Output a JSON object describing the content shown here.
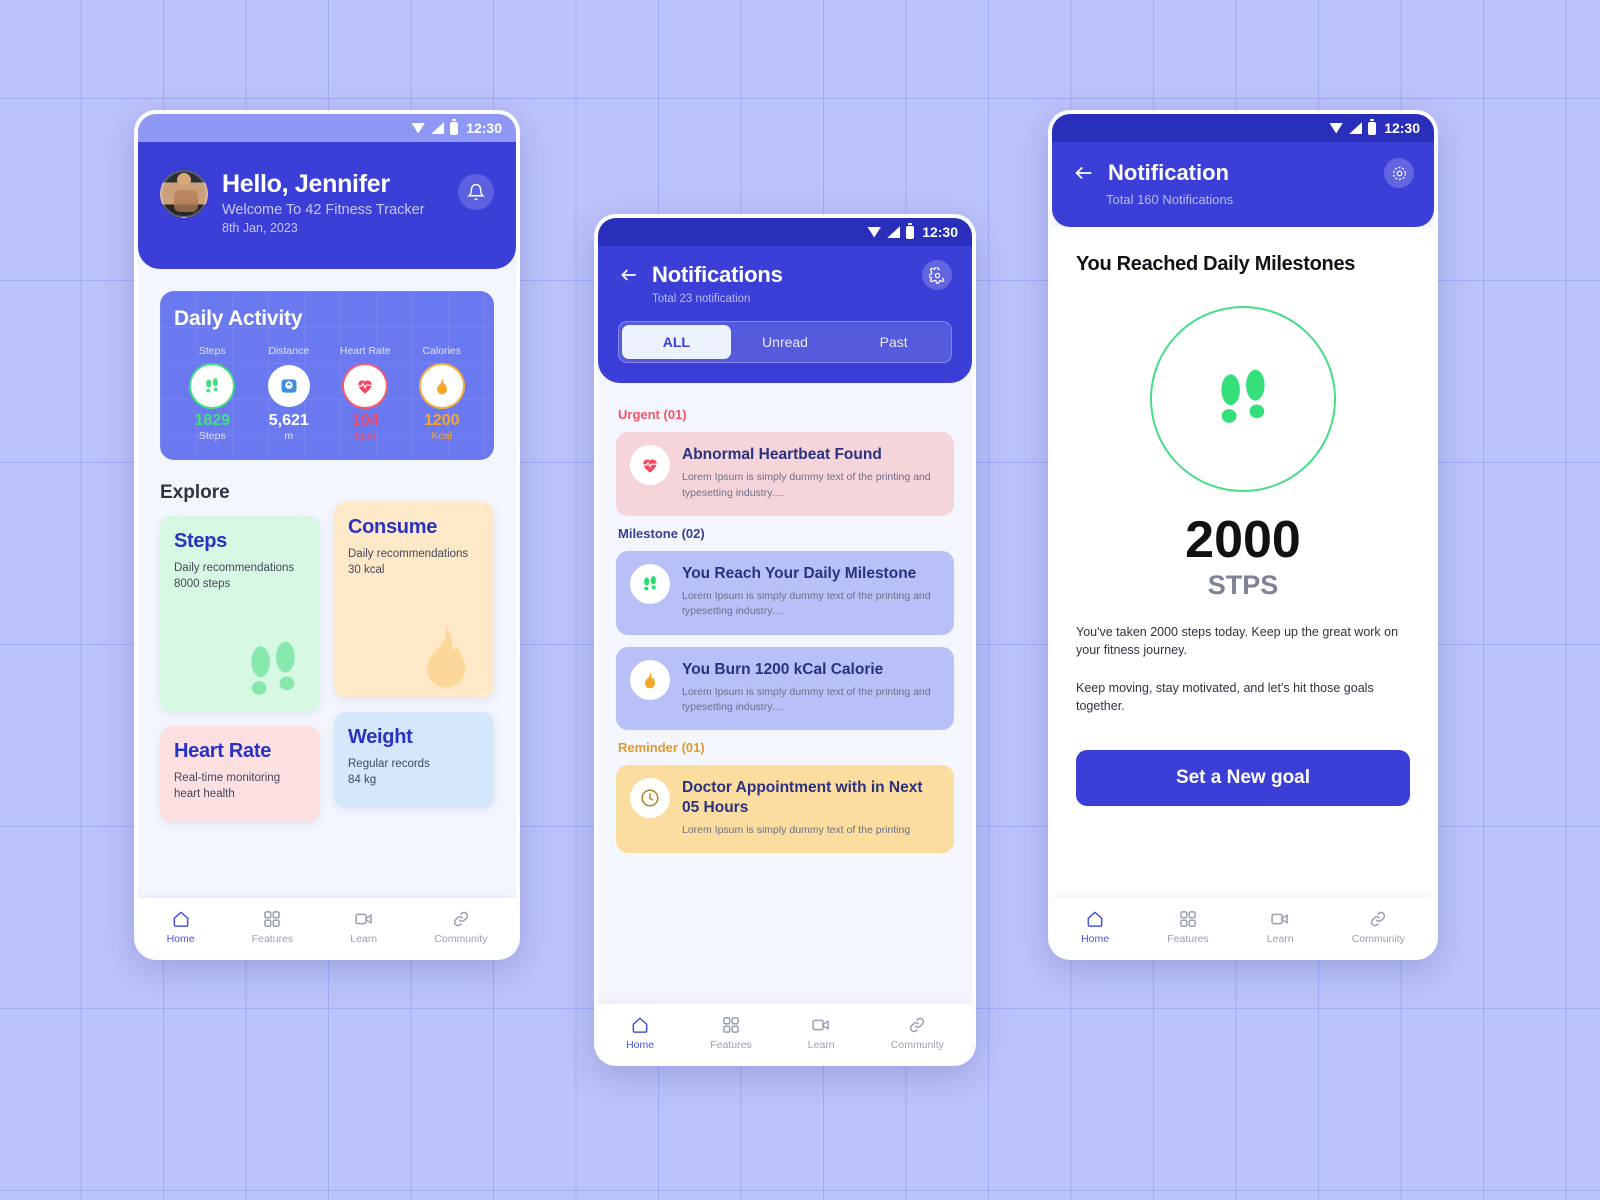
{
  "statusbar": {
    "time": "12:30"
  },
  "home": {
    "greeting": "Hello, Jennifer",
    "welcome": "Welcome To 42 Fitness Tracker",
    "date": "8th Jan, 2023",
    "bell_icon": "bell-icon",
    "daily_activity": {
      "title": "Daily Activity",
      "metrics": [
        {
          "name": "Steps",
          "icon": "footsteps-icon",
          "value": "1829",
          "unit": "Steps",
          "color": "#3fe07e"
        },
        {
          "name": "Distance",
          "icon": "scale-icon",
          "value": "5,621",
          "unit": "m",
          "color": "#ffffff"
        },
        {
          "name": "Heart Rate",
          "icon": "heart-icon",
          "value": "104",
          "unit": "bpm",
          "color": "#f65a6e"
        },
        {
          "name": "Calories",
          "icon": "flame-icon",
          "value": "1200",
          "unit": "Kcal",
          "color": "#f7ae3a"
        }
      ]
    },
    "explore_heading": "Explore",
    "explore_cards": [
      {
        "title": "Steps",
        "desc": "Daily recommendations\n8000 steps",
        "icon": "footsteps-icon"
      },
      {
        "title": "Consume",
        "desc": "Daily recommendations\n30 kcal",
        "icon": "flame-icon"
      },
      {
        "title": "Heart Rate",
        "desc": "Real-time monitoring\nheart health",
        "icon": "heart-icon"
      },
      {
        "title": "Weight",
        "desc": "Regular records\n84 kg",
        "icon": "scale-icon"
      }
    ]
  },
  "notifications": {
    "title": "Notifications",
    "subtitle": "Total 23 notification",
    "back_icon": "arrow-left-icon",
    "settings_icon": "gear-icon",
    "tabs": [
      {
        "label": "ALL",
        "active": true
      },
      {
        "label": "Unread",
        "active": false
      },
      {
        "label": "Past",
        "active": false
      }
    ],
    "groups": [
      {
        "label": "Urgent (01)",
        "label_color": "#f5546b",
        "items": [
          {
            "title": "Abnormal Heartbeat Found",
            "body": "Lorem Ipsum is simply dummy text of the printing and typesetting industry....",
            "icon": "heart-icon",
            "bg": "#f6d5da"
          }
        ]
      },
      {
        "label": "Milestone (02)",
        "label_color": "#3a3f91",
        "items": [
          {
            "title": "You Reach Your Daily Milestone",
            "body": "Lorem Ipsum is simply dummy text of the printing and typesetting industry....",
            "icon": "footsteps-icon",
            "bg": "#b9c0f7"
          },
          {
            "title": "You Burn 1200 kCal Calorie",
            "body": "Lorem Ipsum is simply dummy text of the printing and typesetting industry....",
            "icon": "flame-icon",
            "bg": "#b9c0f7"
          }
        ]
      },
      {
        "label": "Reminder (01)",
        "label_color": "#e09a2e",
        "items": [
          {
            "title": "Doctor Appointment with in Next 05 Hours",
            "body": "Lorem Ipsum is simply dummy text of the printing",
            "icon": "clock-icon",
            "bg": "#fbdda0"
          }
        ]
      }
    ]
  },
  "detail": {
    "title": "Notification",
    "subtitle": "Total 160 Notifications",
    "back_icon": "arrow-left-icon",
    "settings_icon": "gear-icon",
    "heading": "You Reached Daily Milestones",
    "ring_icon": "footsteps-icon",
    "value": "2000",
    "unit": "STPS",
    "paragraph1": "You've taken 2000 steps today. Keep up the great work on your fitness journey.",
    "paragraph2": "Keep moving, stay motivated, and let's hit those goals together.",
    "cta_label": "Set a New goal"
  },
  "bottom_nav": [
    {
      "label": "Home",
      "icon": "home-icon",
      "active": true
    },
    {
      "label": "Features",
      "icon": "grid-icon",
      "active": false
    },
    {
      "label": "Learn",
      "icon": "video-icon",
      "active": false
    },
    {
      "label": "Community",
      "icon": "link-icon",
      "active": false
    }
  ],
  "colors": {
    "primary": "#3b3fd8",
    "card": "#6b79f0",
    "green": "#3fe07e",
    "red": "#f65a6e",
    "orange": "#f7ae3a",
    "bg": "#bcc2fb"
  }
}
